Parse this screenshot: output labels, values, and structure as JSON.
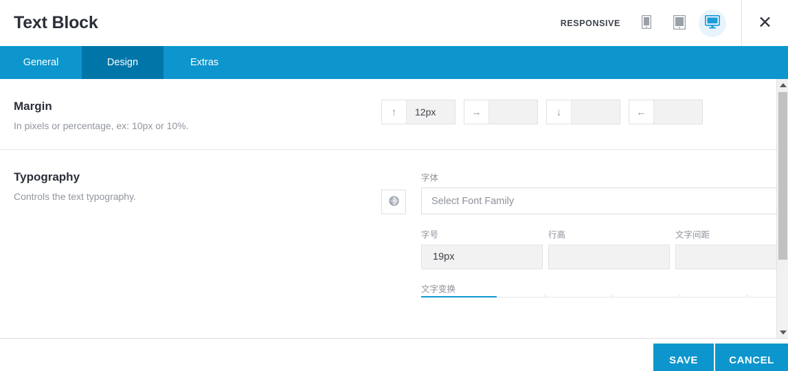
{
  "header": {
    "title": "Text Block",
    "responsive_label": "RESPONSIVE",
    "devices": [
      {
        "name": "mobile",
        "icon": "mobile-icon",
        "active": false
      },
      {
        "name": "tablet",
        "icon": "tablet-icon",
        "active": false
      },
      {
        "name": "desktop",
        "icon": "desktop-icon",
        "active": true
      }
    ],
    "close_label": "✕"
  },
  "tabs": [
    {
      "label": "General",
      "active": false
    },
    {
      "label": "Design",
      "active": true
    },
    {
      "label": "Extras",
      "active": false
    }
  ],
  "sections": {
    "margin": {
      "title": "Margin",
      "description": "In pixels or percentage, ex: 10px or 10%.",
      "inputs": [
        {
          "direction": "top",
          "arrow": "↑",
          "value": "12px",
          "placeholder": ""
        },
        {
          "direction": "right",
          "arrow": "→",
          "value": "",
          "placeholder": ""
        },
        {
          "direction": "bottom",
          "arrow": "↓",
          "value": "",
          "placeholder": ""
        },
        {
          "direction": "left",
          "arrow": "←",
          "value": "",
          "placeholder": ""
        }
      ]
    },
    "typography": {
      "title": "Typography",
      "description": "Controls the text typography.",
      "globe_icon": "globe-icon",
      "font_family": {
        "label": "字体",
        "value": "Select Font Family"
      },
      "font_size": {
        "label": "字号",
        "value": "19px",
        "placeholder": ""
      },
      "line_height": {
        "label": "行高",
        "value": "",
        "placeholder": ""
      },
      "letter_spacing": {
        "label": "文字间距",
        "value": "",
        "placeholder": ""
      },
      "text_transform": {
        "label": "文字变换"
      }
    }
  },
  "footer": {
    "save_label": "SAVE",
    "cancel_label": "CANCEL"
  },
  "colors": {
    "accent": "#0d96cd",
    "accent_dark": "#0076a8",
    "active_device_bg": "#e8f4fc",
    "text_dark": "#2b2f38",
    "text_muted": "#90959d",
    "input_bg": "#f2f2f2"
  }
}
